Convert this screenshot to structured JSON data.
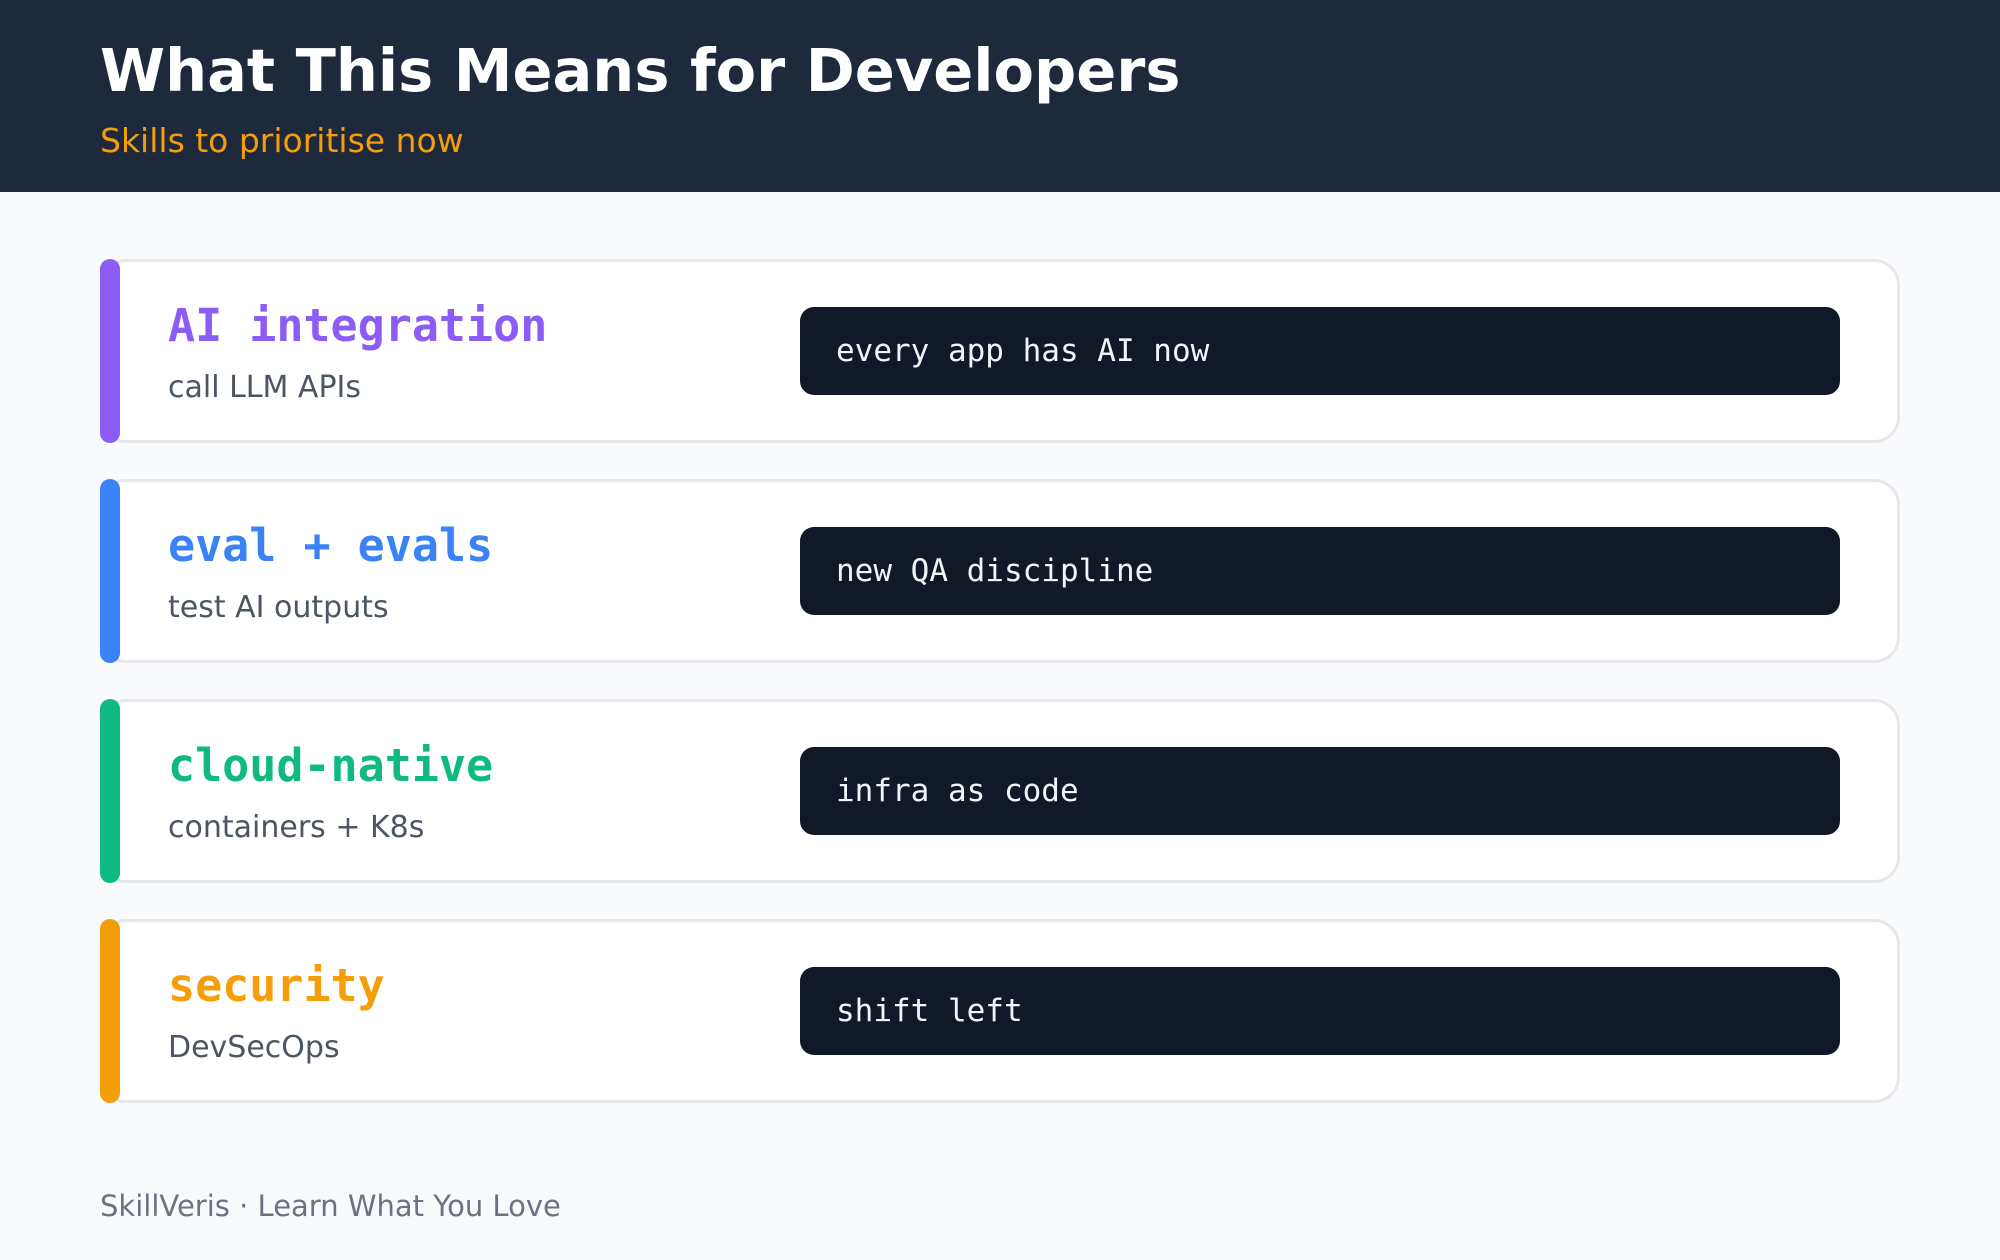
{
  "header": {
    "title": "What This Means for Developers",
    "subtitle": "Skills to prioritise now"
  },
  "skills": [
    {
      "title": "AI integration",
      "subtitle": "call LLM APIs",
      "note": "every app has AI now",
      "color": "#8b5cf6"
    },
    {
      "title": "eval + evals",
      "subtitle": "test AI outputs",
      "note": "new QA discipline",
      "color": "#3b82f6"
    },
    {
      "title": "cloud-native",
      "subtitle": "containers + K8s",
      "note": "infra as code",
      "color": "#10b981"
    },
    {
      "title": "security",
      "subtitle": "DevSecOps",
      "note": "shift left",
      "color": "#f59e0b"
    }
  ],
  "footer": {
    "text": "SkillVeris · Learn What You Love"
  }
}
